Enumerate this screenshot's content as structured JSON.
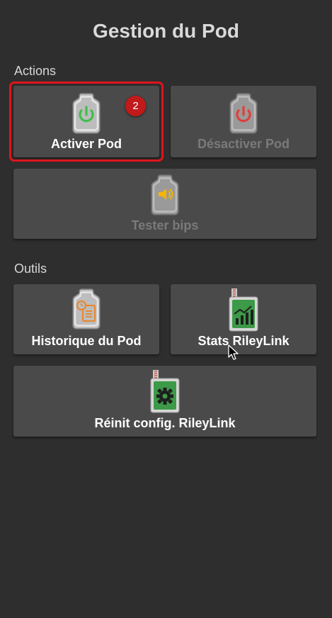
{
  "header": {
    "title": "Gestion du Pod"
  },
  "sections": {
    "actions": "Actions",
    "outils": "Outils"
  },
  "buttons": {
    "activate": {
      "label": "Activer Pod",
      "icon": "power-green-pod-icon",
      "enabled": true
    },
    "deactivate": {
      "label": "Désactiver Pod",
      "icon": "power-red-pod-icon",
      "enabled": false
    },
    "test_beeps": {
      "label": "Tester bips",
      "icon": "speaker-pod-icon",
      "enabled": false
    },
    "pod_history": {
      "label": "Historique du Pod",
      "icon": "clock-list-pod-icon",
      "enabled": true
    },
    "rileylink_stats": {
      "label": "Stats RileyLink",
      "icon": "rileylink-chart-icon",
      "enabled": true
    },
    "reset_rileylink": {
      "label": "Réinit config. RileyLink",
      "icon": "rileylink-gear-icon",
      "enabled": true
    }
  },
  "annotation": {
    "badge": "2"
  },
  "colors": {
    "background": "#2e2e2e",
    "button": "#4a4a4a",
    "highlight": "#e0141b",
    "power_green": "#3fbf4a",
    "power_red": "#e0403a",
    "speaker": "#f4b400",
    "history_orange": "#e8862a",
    "rileylink_green": "#3c9a48"
  }
}
